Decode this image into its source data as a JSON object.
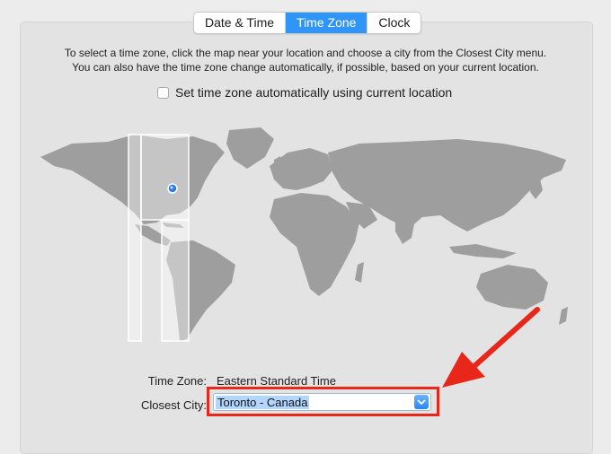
{
  "tabs": [
    {
      "label": "Date & Time",
      "selected": false
    },
    {
      "label": "Time Zone",
      "selected": true
    },
    {
      "label": "Clock",
      "selected": false
    }
  ],
  "instructions": {
    "line1": "To select a time zone, click the map near your location and choose a city from the Closest City menu.",
    "line2": "You can also have the time zone change automatically, if possible, based on your current location."
  },
  "auto_timezone": {
    "label": "Set time zone automatically using current location",
    "checked": false
  },
  "map": {
    "selected_region_icon": "location-pin-icon"
  },
  "time_zone": {
    "label": "Time Zone:",
    "value": "Eastern Standard Time"
  },
  "closest_city": {
    "label": "Closest City:",
    "value": "Toronto - Canada"
  },
  "colors": {
    "accent": "#2f95f7",
    "annotation": "#e8261a",
    "land": "#9e9e9e"
  }
}
